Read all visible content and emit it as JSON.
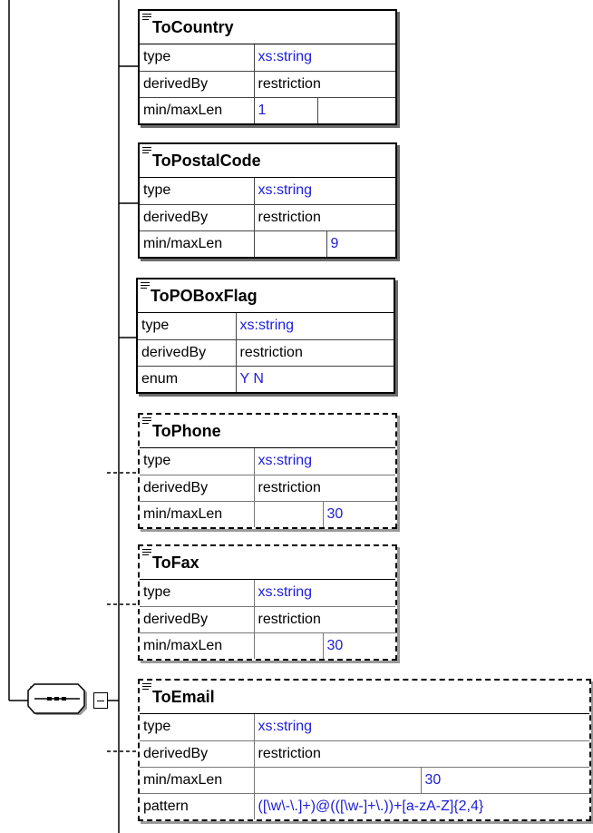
{
  "elements": [
    {
      "name": "ToCountry",
      "optional": false,
      "doc_icon": "documentation-icon",
      "rows": [
        {
          "label": "type",
          "values": [
            "xs:string"
          ]
        },
        {
          "label": "derivedBy",
          "values": [
            "restriction"
          ],
          "plain": true
        },
        {
          "label": "min/maxLen",
          "values": [
            "1",
            ""
          ]
        }
      ]
    },
    {
      "name": "ToPostalCode",
      "optional": false,
      "doc_icon": "documentation-icon",
      "rows": [
        {
          "label": "type",
          "values": [
            "xs:string"
          ]
        },
        {
          "label": "derivedBy",
          "values": [
            "restriction"
          ],
          "plain": true
        },
        {
          "label": "min/maxLen",
          "values": [
            "",
            "9"
          ]
        }
      ]
    },
    {
      "name": "ToPOBoxFlag",
      "optional": false,
      "doc_icon": "documentation-icon",
      "rows": [
        {
          "label": "type",
          "values": [
            "xs:string"
          ]
        },
        {
          "label": "derivedBy",
          "values": [
            "restriction"
          ],
          "plain": true
        },
        {
          "label": "enum",
          "values": [
            "Y N"
          ]
        }
      ]
    },
    {
      "name": "ToPhone",
      "optional": true,
      "doc_icon": "documentation-icon",
      "rows": [
        {
          "label": "type",
          "values": [
            "xs:string"
          ]
        },
        {
          "label": "derivedBy",
          "values": [
            "restriction"
          ],
          "plain": true
        },
        {
          "label": "min/maxLen",
          "values": [
            "",
            "30"
          ]
        }
      ]
    },
    {
      "name": "ToFax",
      "optional": true,
      "doc_icon": "documentation-icon",
      "rows": [
        {
          "label": "type",
          "values": [
            "xs:string"
          ]
        },
        {
          "label": "derivedBy",
          "values": [
            "restriction"
          ],
          "plain": true
        },
        {
          "label": "min/maxLen",
          "values": [
            "",
            "30"
          ]
        }
      ]
    },
    {
      "name": "ToEmail",
      "optional": true,
      "doc_icon": "documentation-icon",
      "rows": [
        {
          "label": "type",
          "values": [
            "xs:string"
          ]
        },
        {
          "label": "derivedBy",
          "values": [
            "restriction"
          ],
          "plain": true
        },
        {
          "label": "min/maxLen",
          "values": [
            "",
            "30"
          ]
        },
        {
          "label": "pattern",
          "values": [
            "([\\w\\-\\.]+)@(([\\w-]+\\.))+[a-zA-Z]{2,4}"
          ]
        }
      ]
    }
  ],
  "sequence_node": {
    "icon": "sequence-compositor-icon",
    "collapse_icon": "collapse-minus-icon"
  },
  "colors": {
    "value_text": "#1d1dd8",
    "border": "#000000",
    "shadow": "#6b6b6b"
  }
}
